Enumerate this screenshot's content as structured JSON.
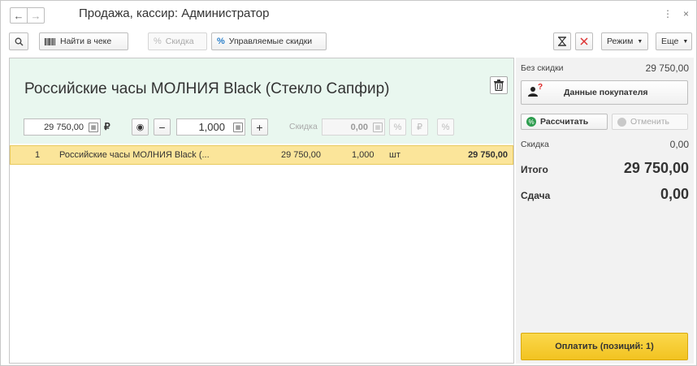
{
  "window": {
    "title": "Продажа, кассир: Администратор",
    "menu_glyph": "⋮",
    "close_glyph": "×"
  },
  "toolbar": {
    "find_in_receipt": "Найти в чеке",
    "discount": "Скидка",
    "managed_discounts": "Управляемые скидки",
    "mode": "Режим",
    "more": "Еще"
  },
  "product": {
    "title": "Российские часы МОЛНИЯ Black (Стекло Сапфир)",
    "price": "29 750,00",
    "currency_symbol": "₽",
    "quantity": "1,000",
    "discount_label": "Скидка",
    "discount_value": "0,00"
  },
  "receipt": {
    "rows": [
      {
        "num": "1",
        "name": "Российские часы МОЛНИЯ Black (...",
        "price": "29 750,00",
        "qty": "1,000",
        "unit": "шт",
        "total": "29 750,00"
      }
    ]
  },
  "summary": {
    "no_discount_label": "Без скидки",
    "no_discount_value": "29 750,00",
    "customer_data": "Данные покупателя",
    "calculate": "Рассчитать",
    "cancel": "Отменить",
    "discount_label": "Скидка",
    "discount_value": "0,00",
    "total_label": "Итого",
    "total_value": "29 750,00",
    "change_label": "Сдача",
    "change_value": "0,00",
    "pay_button": "Оплатить (позиций: 1)"
  },
  "colors": {
    "accent_green": "#e9f7ef",
    "row_highlight": "#fbe59a",
    "pay_yellow": "#f2c321",
    "calc_green": "#2e9d4f"
  }
}
